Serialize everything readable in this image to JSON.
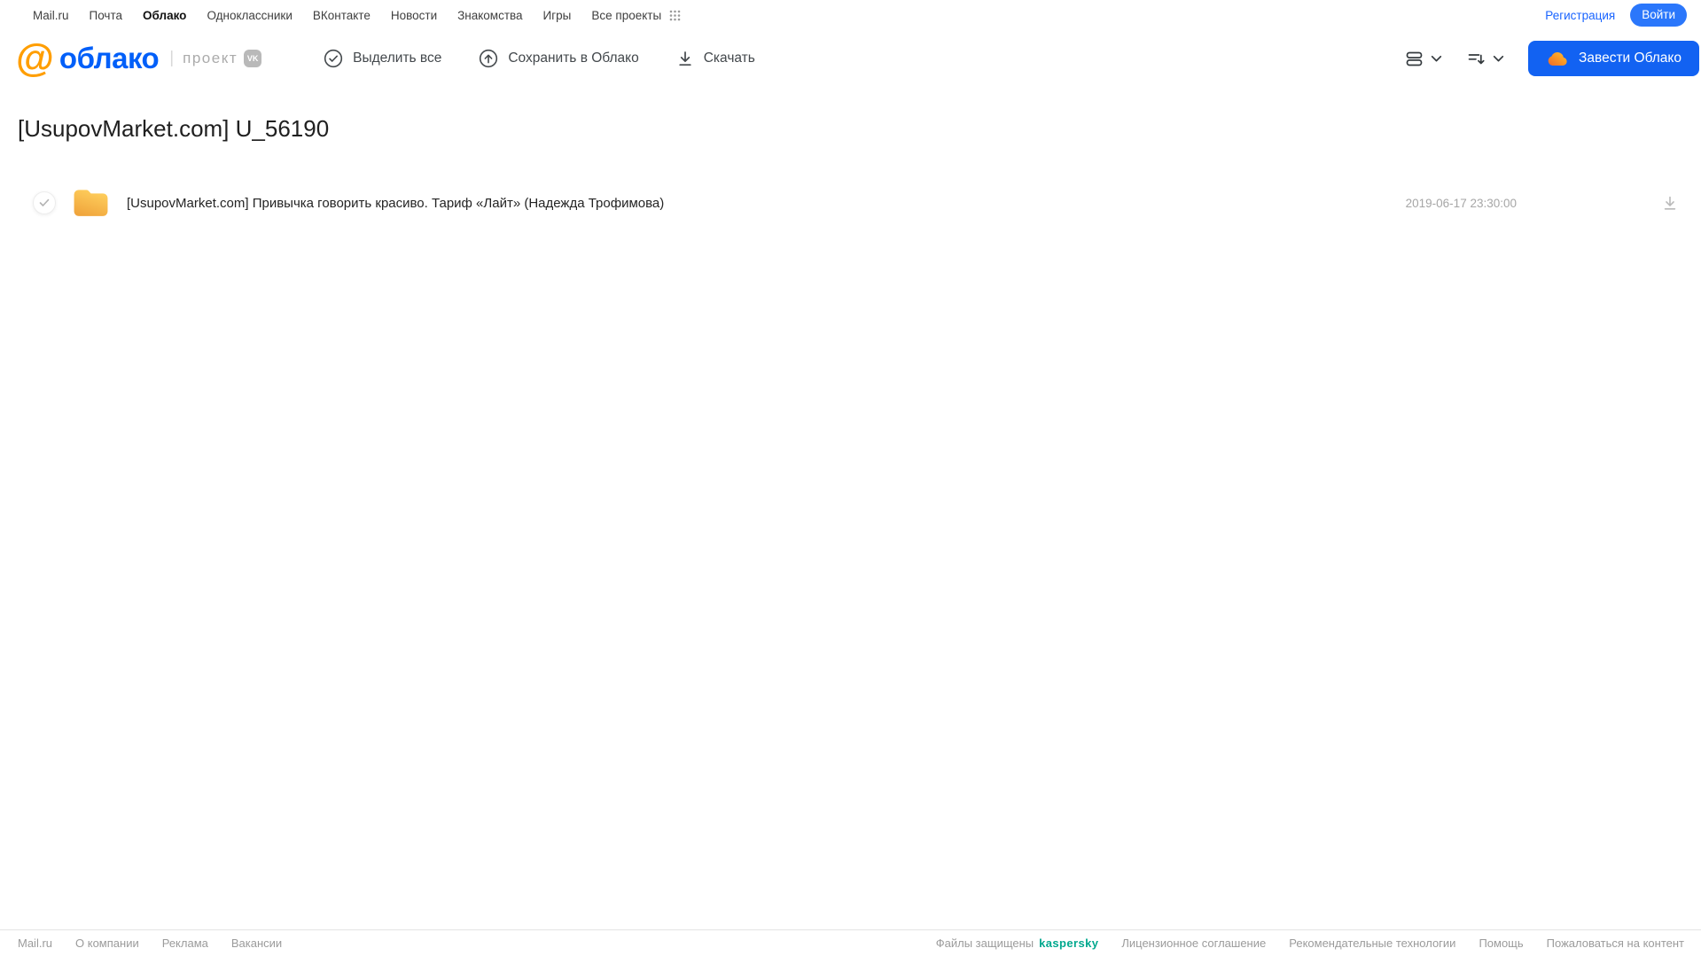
{
  "topnav": {
    "links": [
      "Mail.ru",
      "Почта",
      "Облако",
      "Одноклассники",
      "ВКонтакте",
      "Новости",
      "Знакомства",
      "Игры",
      "Все проекты"
    ],
    "active_link": "Облако",
    "registration": "Регистрация",
    "login": "Войти"
  },
  "header": {
    "logo": {
      "at": "@",
      "text": "облако",
      "project": "проект",
      "vk": "VK"
    },
    "toolbar": {
      "select_all": "Выделить все",
      "save_to_cloud": "Сохранить в Облако",
      "download": "Скачать"
    },
    "cta": "Завести Облако"
  },
  "page": {
    "title": "[UsupovMarket.com] U_56190"
  },
  "files": {
    "items": [
      {
        "type": "folder",
        "name": "[UsupovMarket.com] Привычка говорить красиво. Тариф «Лайт» (Надежда Трофимова)",
        "date": "2019-06-17 23:30:00"
      }
    ]
  },
  "footer": {
    "left_links": [
      "Mail.ru",
      "О компании",
      "Реклама",
      "Вакансии"
    ],
    "protected_label": "Файлы защищены",
    "kaspersky": "kaspersky",
    "right_links": [
      "Лицензионное соглашение",
      "Рекомендательные технологии",
      "Помощь",
      "Пожаловаться на контент"
    ]
  },
  "icons": {
    "apps_grid": "apps-grid-icon",
    "select_all": "check-circle-icon",
    "save_to_cloud": "cloud-upload-icon",
    "download": "download-icon",
    "view_mode": "rows-view-icon",
    "sort": "sort-icon",
    "chevron": "chevron-down-icon",
    "cta_cloud": "cloud-icon",
    "file": "folder-icon",
    "row_check": "check-icon",
    "row_download": "download-icon"
  },
  "colors": {
    "brand_blue": "#005FF9",
    "brand_orange": "#FF9E00",
    "cta_blue": "#1262F2",
    "login_blue": "#2B77FB",
    "link_blue": "#1964FF",
    "kaspersky_green": "#00A88E",
    "folder_top": "#FFD05E",
    "folder_bottom": "#F0A53C",
    "toolbar_gray": "#43484C",
    "muted_gray": "#A6A6A6"
  }
}
